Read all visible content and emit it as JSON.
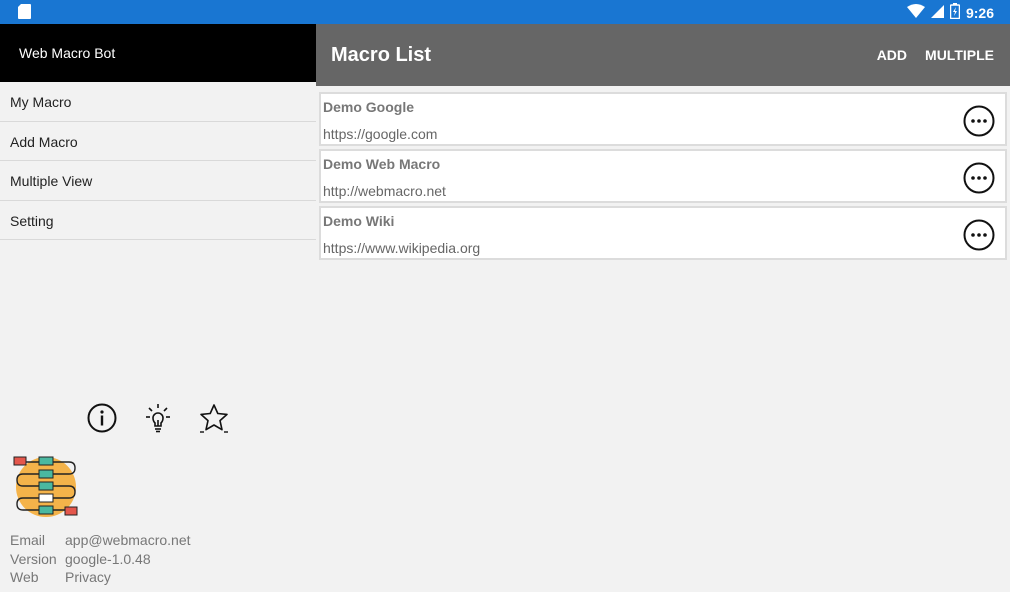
{
  "status": {
    "time": "9:26"
  },
  "drawer": {
    "title": "Web Macro Bot",
    "menu": [
      {
        "label": "My Macro"
      },
      {
        "label": "Add Macro"
      },
      {
        "label": "Multiple View"
      },
      {
        "label": "Setting"
      }
    ],
    "footer_icons": [
      "info-icon",
      "lightbulb-icon",
      "star-icon"
    ],
    "info": [
      {
        "key": "Email",
        "value": "app@webmacro.net"
      },
      {
        "key": "Version",
        "value": "google-1.0.48"
      },
      {
        "key": "Web",
        "value": "Privacy"
      }
    ]
  },
  "appbar": {
    "title": "Macro List",
    "actions": {
      "add": "ADD",
      "multiple": "MULTIPLE"
    }
  },
  "macros": [
    {
      "name": "Demo Google",
      "url": "https://google.com"
    },
    {
      "name": "Demo Web Macro",
      "url": "http://webmacro.net"
    },
    {
      "name": "Demo Wiki",
      "url": "https://www.wikipedia.org"
    }
  ],
  "colors": {
    "statusbar": "#1976d2",
    "appbar": "#666666",
    "drawer_header": "#000000"
  }
}
